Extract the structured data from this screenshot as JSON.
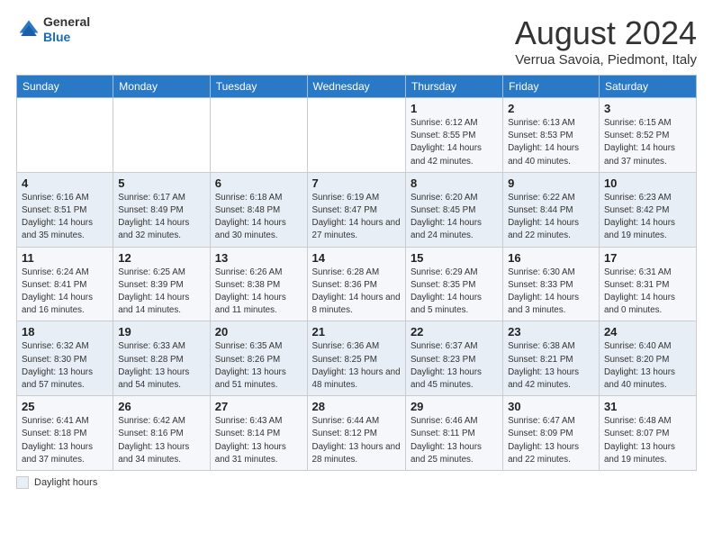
{
  "header": {
    "logo_line1": "General",
    "logo_line2": "Blue",
    "month": "August 2024",
    "location": "Verrua Savoia, Piedmont, Italy"
  },
  "days_of_week": [
    "Sunday",
    "Monday",
    "Tuesday",
    "Wednesday",
    "Thursday",
    "Friday",
    "Saturday"
  ],
  "weeks": [
    [
      {
        "day": "",
        "info": ""
      },
      {
        "day": "",
        "info": ""
      },
      {
        "day": "",
        "info": ""
      },
      {
        "day": "",
        "info": ""
      },
      {
        "day": "1",
        "info": "Sunrise: 6:12 AM\nSunset: 8:55 PM\nDaylight: 14 hours and 42 minutes."
      },
      {
        "day": "2",
        "info": "Sunrise: 6:13 AM\nSunset: 8:53 PM\nDaylight: 14 hours and 40 minutes."
      },
      {
        "day": "3",
        "info": "Sunrise: 6:15 AM\nSunset: 8:52 PM\nDaylight: 14 hours and 37 minutes."
      }
    ],
    [
      {
        "day": "4",
        "info": "Sunrise: 6:16 AM\nSunset: 8:51 PM\nDaylight: 14 hours and 35 minutes."
      },
      {
        "day": "5",
        "info": "Sunrise: 6:17 AM\nSunset: 8:49 PM\nDaylight: 14 hours and 32 minutes."
      },
      {
        "day": "6",
        "info": "Sunrise: 6:18 AM\nSunset: 8:48 PM\nDaylight: 14 hours and 30 minutes."
      },
      {
        "day": "7",
        "info": "Sunrise: 6:19 AM\nSunset: 8:47 PM\nDaylight: 14 hours and 27 minutes."
      },
      {
        "day": "8",
        "info": "Sunrise: 6:20 AM\nSunset: 8:45 PM\nDaylight: 14 hours and 24 minutes."
      },
      {
        "day": "9",
        "info": "Sunrise: 6:22 AM\nSunset: 8:44 PM\nDaylight: 14 hours and 22 minutes."
      },
      {
        "day": "10",
        "info": "Sunrise: 6:23 AM\nSunset: 8:42 PM\nDaylight: 14 hours and 19 minutes."
      }
    ],
    [
      {
        "day": "11",
        "info": "Sunrise: 6:24 AM\nSunset: 8:41 PM\nDaylight: 14 hours and 16 minutes."
      },
      {
        "day": "12",
        "info": "Sunrise: 6:25 AM\nSunset: 8:39 PM\nDaylight: 14 hours and 14 minutes."
      },
      {
        "day": "13",
        "info": "Sunrise: 6:26 AM\nSunset: 8:38 PM\nDaylight: 14 hours and 11 minutes."
      },
      {
        "day": "14",
        "info": "Sunrise: 6:28 AM\nSunset: 8:36 PM\nDaylight: 14 hours and 8 minutes."
      },
      {
        "day": "15",
        "info": "Sunrise: 6:29 AM\nSunset: 8:35 PM\nDaylight: 14 hours and 5 minutes."
      },
      {
        "day": "16",
        "info": "Sunrise: 6:30 AM\nSunset: 8:33 PM\nDaylight: 14 hours and 3 minutes."
      },
      {
        "day": "17",
        "info": "Sunrise: 6:31 AM\nSunset: 8:31 PM\nDaylight: 14 hours and 0 minutes."
      }
    ],
    [
      {
        "day": "18",
        "info": "Sunrise: 6:32 AM\nSunset: 8:30 PM\nDaylight: 13 hours and 57 minutes."
      },
      {
        "day": "19",
        "info": "Sunrise: 6:33 AM\nSunset: 8:28 PM\nDaylight: 13 hours and 54 minutes."
      },
      {
        "day": "20",
        "info": "Sunrise: 6:35 AM\nSunset: 8:26 PM\nDaylight: 13 hours and 51 minutes."
      },
      {
        "day": "21",
        "info": "Sunrise: 6:36 AM\nSunset: 8:25 PM\nDaylight: 13 hours and 48 minutes."
      },
      {
        "day": "22",
        "info": "Sunrise: 6:37 AM\nSunset: 8:23 PM\nDaylight: 13 hours and 45 minutes."
      },
      {
        "day": "23",
        "info": "Sunrise: 6:38 AM\nSunset: 8:21 PM\nDaylight: 13 hours and 42 minutes."
      },
      {
        "day": "24",
        "info": "Sunrise: 6:40 AM\nSunset: 8:20 PM\nDaylight: 13 hours and 40 minutes."
      }
    ],
    [
      {
        "day": "25",
        "info": "Sunrise: 6:41 AM\nSunset: 8:18 PM\nDaylight: 13 hours and 37 minutes."
      },
      {
        "day": "26",
        "info": "Sunrise: 6:42 AM\nSunset: 8:16 PM\nDaylight: 13 hours and 34 minutes."
      },
      {
        "day": "27",
        "info": "Sunrise: 6:43 AM\nSunset: 8:14 PM\nDaylight: 13 hours and 31 minutes."
      },
      {
        "day": "28",
        "info": "Sunrise: 6:44 AM\nSunset: 8:12 PM\nDaylight: 13 hours and 28 minutes."
      },
      {
        "day": "29",
        "info": "Sunrise: 6:46 AM\nSunset: 8:11 PM\nDaylight: 13 hours and 25 minutes."
      },
      {
        "day": "30",
        "info": "Sunrise: 6:47 AM\nSunset: 8:09 PM\nDaylight: 13 hours and 22 minutes."
      },
      {
        "day": "31",
        "info": "Sunrise: 6:48 AM\nSunset: 8:07 PM\nDaylight: 13 hours and 19 minutes."
      }
    ]
  ],
  "footer": {
    "daylight_label": "Daylight hours"
  }
}
